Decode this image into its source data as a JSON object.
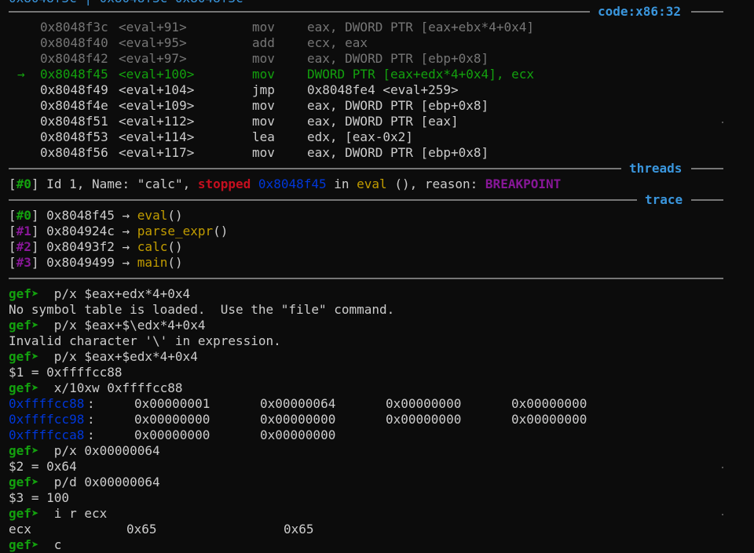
{
  "top_partial": "0x8048f3c | 0x8048f3c 0x8048f3c",
  "code_header": {
    "label": "code:x86:32"
  },
  "code_lines": [
    {
      "addr": "0x8048f3c",
      "sym": "<eval+91>",
      "op": "mov",
      "args": "eax, DWORD PTR [eax+ebx*4+0x4]",
      "state": "past"
    },
    {
      "addr": "0x8048f40",
      "sym": "<eval+95>",
      "op": "add",
      "args": "ecx, eax",
      "state": "past"
    },
    {
      "addr": "0x8048f42",
      "sym": "<eval+97>",
      "op": "mov",
      "args": "eax, DWORD PTR [ebp+0x8]",
      "state": "past"
    },
    {
      "addr": "0x8048f45",
      "sym": "<eval+100>",
      "op": "mov",
      "args": "DWORD PTR [eax+edx*4+0x4], ecx",
      "state": "current",
      "arrow": "→"
    },
    {
      "addr": "0x8048f49",
      "sym": "<eval+104>",
      "op": "jmp",
      "args": "0x8048fe4 <eval+259>",
      "state": "future"
    },
    {
      "addr": "0x8048f4e",
      "sym": "<eval+109>",
      "op": "mov",
      "args": "eax, DWORD PTR [ebp+0x8]",
      "state": "future"
    },
    {
      "addr": "0x8048f51",
      "sym": "<eval+112>",
      "op": "mov",
      "args": "eax, DWORD PTR [eax]",
      "state": "future"
    },
    {
      "addr": "0x8048f53",
      "sym": "<eval+114>",
      "op": "lea",
      "args": "edx, [eax-0x2]",
      "state": "future"
    },
    {
      "addr": "0x8048f56",
      "sym": "<eval+117>",
      "op": "mov",
      "args": "eax, DWORD PTR [ebp+0x8]",
      "state": "future"
    }
  ],
  "threads_header": {
    "label": "threads"
  },
  "thread": {
    "idx": "#0",
    "text1": " Id 1, Name: \"calc\", ",
    "stopped": "stopped",
    "addr": "0x8048f45",
    "in": " in ",
    "func": "eval",
    "text2": " (), reason: ",
    "reason": "BREAKPOINT"
  },
  "trace_header": {
    "label": "trace"
  },
  "trace": [
    {
      "idx": "#0",
      "addr": "0x8048f45",
      "arrow": "→",
      "func": "eval"
    },
    {
      "idx": "#1",
      "addr": "0x804924c",
      "arrow": "→",
      "func": "parse_expr"
    },
    {
      "idx": "#2",
      "addr": "0x80493f2",
      "arrow": "→",
      "func": "calc"
    },
    {
      "idx": "#3",
      "addr": "0x8049499",
      "arrow": "→",
      "func": "main"
    }
  ],
  "console": {
    "prompt": "gef➤",
    "lines": [
      {
        "type": "cmd",
        "text": "p/x $eax+edx*4+0x4"
      },
      {
        "type": "out",
        "text": "No symbol table is loaded.  Use the \"file\" command."
      },
      {
        "type": "cmd",
        "text": "p/x $eax+$\\edx*4+0x4"
      },
      {
        "type": "out",
        "text": "Invalid character '\\' in expression."
      },
      {
        "type": "cmd",
        "text": "p/x $eax+$edx*4+0x4"
      },
      {
        "type": "out",
        "text": "$1 = 0xffffcc88"
      },
      {
        "type": "cmd",
        "text": "x/10xw 0xffffcc88"
      }
    ],
    "memory": [
      {
        "addr": "0xffffcc88",
        "vals": [
          "0x00000001",
          "0x00000064",
          "0x00000000",
          "0x00000000"
        ]
      },
      {
        "addr": "0xffffcc98",
        "vals": [
          "0x00000000",
          "0x00000000",
          "0x00000000",
          "0x00000000"
        ]
      },
      {
        "addr": "0xffffcca8",
        "vals": [
          "0x00000000",
          "0x00000000"
        ]
      }
    ],
    "lines2": [
      {
        "type": "cmd",
        "text": "p/x 0x00000064"
      },
      {
        "type": "out",
        "text": "$2 = 0x64"
      },
      {
        "type": "cmd",
        "text": "p/d 0x00000064"
      },
      {
        "type": "out",
        "text": "$3 = 100"
      },
      {
        "type": "cmd",
        "text": "i r ecx"
      }
    ],
    "register": {
      "name": "ecx",
      "hex": "0x65",
      "raw": "0x65"
    },
    "last_prompt": "gef➤",
    "last_partial": "c"
  }
}
